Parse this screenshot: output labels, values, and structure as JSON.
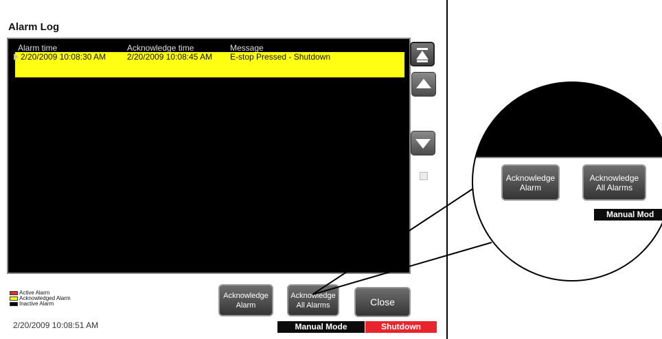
{
  "window": {
    "title": "Alarm Log"
  },
  "log": {
    "columns": [
      "Alarm time",
      "Acknowledge time",
      "Message"
    ],
    "rows": [
      {
        "alarm_time": "2/20/2009 10:08:30 AM",
        "ack_time": "2/20/2009 10:08:45 AM",
        "message": "E-stop Pressed - Shutdown",
        "status": "acknowledged"
      }
    ]
  },
  "scroll": {
    "top_icon": "scroll-top-icon",
    "up_icon": "scroll-up-icon",
    "down_icon": "scroll-down-icon"
  },
  "legend": {
    "items": [
      {
        "label": "Active Alarm",
        "color": "#e03030"
      },
      {
        "label": "Acknowledged Alarm",
        "color": "#ffff14"
      },
      {
        "label": "Inactive Alarm",
        "color": "#000000"
      }
    ]
  },
  "footer": {
    "timestamp": "2/20/2009 10:08:51 AM"
  },
  "buttons": {
    "ack_line1": "Acknowledge",
    "ack_line2": "Alarm",
    "ackall_line1": "Acknowledge",
    "ackall_line2": "All Alarms",
    "close": "Close"
  },
  "status": {
    "mode": "Manual Mode",
    "state": "Shutdown",
    "state_color": "#e8252c"
  },
  "zoom": {
    "ack_line1": "Acknowledge",
    "ack_line2": "Alarm",
    "ackall_line1": "Acknowledge",
    "ackall_line2": "All Alarms",
    "mode": "Manual Mod"
  }
}
